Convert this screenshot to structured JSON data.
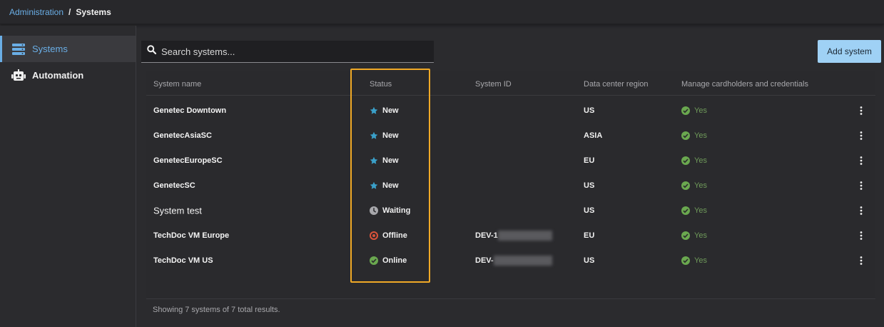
{
  "breadcrumb": {
    "parent": "Administration",
    "separator": "/",
    "current": "Systems"
  },
  "sidebar": {
    "items": [
      {
        "label": "Systems",
        "icon": "server-stack-icon"
      },
      {
        "label": "Automation",
        "icon": "robot-icon"
      }
    ]
  },
  "search": {
    "placeholder": "Search systems..."
  },
  "toolbar": {
    "add_label": "Add system"
  },
  "table": {
    "headers": {
      "name": "System name",
      "status": "Status",
      "id": "System ID",
      "region": "Data center region",
      "manage": "Manage cardholders and credentials"
    },
    "rows": [
      {
        "name": "Genetec Downtown",
        "status": "New",
        "status_icon": "star-icon",
        "id": "",
        "region": "US",
        "manage": "Yes"
      },
      {
        "name": "GenetecAsiaSC",
        "status": "New",
        "status_icon": "star-icon",
        "id": "",
        "region": "ASIA",
        "manage": "Yes"
      },
      {
        "name": "GenetecEuropeSC",
        "status": "New",
        "status_icon": "star-icon",
        "id": "",
        "region": "EU",
        "manage": "Yes"
      },
      {
        "name": "GenetecSC",
        "status": "New",
        "status_icon": "star-icon",
        "id": "",
        "region": "US",
        "manage": "Yes"
      },
      {
        "name": "System test",
        "status": "Waiting",
        "status_icon": "clock-icon",
        "id": "",
        "region": "US",
        "manage": "Yes"
      },
      {
        "name": "TechDoc VM Europe",
        "status": "Offline",
        "status_icon": "offline-icon",
        "id": "DEV-1",
        "region": "EU",
        "manage": "Yes"
      },
      {
        "name": "TechDoc VM US",
        "status": "Online",
        "status_icon": "check-circle-icon",
        "id": "DEV-",
        "region": "US",
        "manage": "Yes"
      }
    ]
  },
  "footer": {
    "summary": "Showing 7 systems of 7 total results."
  },
  "colors": {
    "accent": "#6aaee6",
    "button": "#9fd1f5",
    "new_star": "#3aa0c9",
    "offline": "#d9533a",
    "online": "#6aa84f",
    "yes": "#6f9a5a",
    "highlight": "#f0a926"
  }
}
